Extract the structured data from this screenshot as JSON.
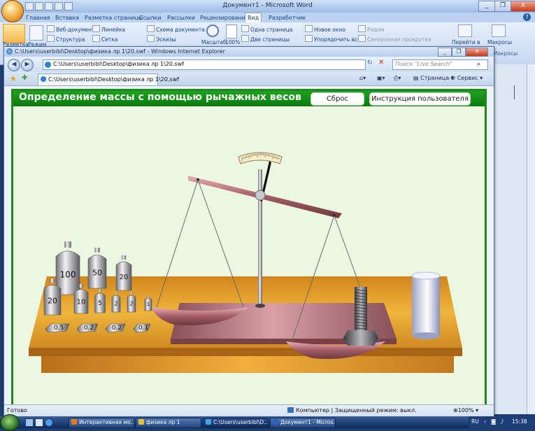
{
  "word": {
    "title": "Документ1 - Microsoft Word",
    "window_controls": [
      "_",
      "❐",
      "X"
    ],
    "tabs": [
      "Главная",
      "Вставка",
      "Разметка страницы",
      "Ссылки",
      "Рассылки",
      "Рецензирование",
      "Вид",
      "Разработчик"
    ],
    "active_tab": "Вид",
    "ribbon": {
      "layout_button": "Разметка",
      "mode_button": "Режим",
      "web_doc": "Веб-документ",
      "structure": "Структура",
      "ruler": "Линейка",
      "grid": "Сетка",
      "doc_map": "Схема документа",
      "thumbnails": "Эскизы",
      "zoom": "Масштаб",
      "zoom_100": "100%",
      "one_page": "Одна страница",
      "two_pages": "Две страницы",
      "new_window": "Новое окно",
      "arrange_all": "Упорядочить все",
      "side_by_side": "Рядом",
      "sync_scroll": "Синхронная прокрутка",
      "switch_windows": "Перейти в",
      "macros": "Макросы",
      "macros_group": "Макросы"
    }
  },
  "ie": {
    "title": "C:\\Users\\userbibl\\Desktop\\физика лр 1\\20.swf - Windows Internet Explorer",
    "address": "C:\\Users\\userbibl\\Desktop\\физика лр 1\\20.swf",
    "search_placeholder": "Поиск \"Live Search\"",
    "tab_label": "C:\\Users\\userbibl\\Desktop\\физика лр 1\\20.swf",
    "page_menu": "Страница",
    "tools_menu": "Сервис",
    "status_left": "Готово",
    "status_zone": "Компьютер | Защищенный режим: выкл.",
    "zoom": "100%"
  },
  "flash": {
    "title": "Определение массы с помощью рычажных весов",
    "reset_button": "Сброс",
    "help_button": "Инструкция пользователя",
    "weights": [
      "100",
      "50",
      "20",
      "20",
      "10",
      "5",
      "2",
      "2",
      "1"
    ],
    "small_weights": [
      "0.5",
      "0.2",
      "0.2",
      "0.1"
    ]
  },
  "taskbar": {
    "items": [
      "Интерактивная мо...",
      "физика лр 1",
      "C:\\Users\\userbibl\\D...",
      "Документ1 - Micros..."
    ],
    "language": "RU",
    "clock": "15:38"
  },
  "colors": {
    "flash_green": "#1ea21e",
    "table_orange": "#e2a21e",
    "beam_brown": "#a8666c"
  }
}
